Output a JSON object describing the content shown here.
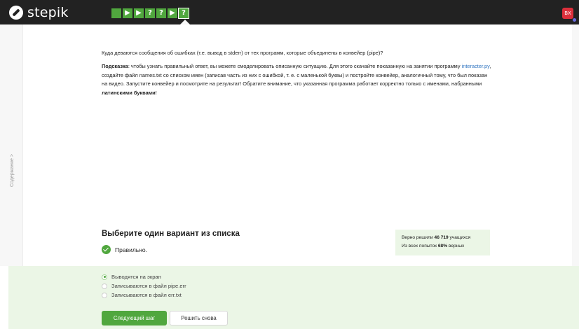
{
  "header": {
    "logo_text": "stepik",
    "steps": [
      {
        "icon": "check-square-icon",
        "glyph": " ",
        "state": "done"
      },
      {
        "icon": "play-icon",
        "glyph": "▶",
        "state": "done"
      },
      {
        "icon": "play-icon",
        "glyph": "▶",
        "state": "done"
      },
      {
        "icon": "question-icon",
        "glyph": "?",
        "state": "done"
      },
      {
        "icon": "question-icon",
        "glyph": "?",
        "state": "done"
      },
      {
        "icon": "play-icon",
        "glyph": "▶",
        "state": "done"
      },
      {
        "icon": "question-icon",
        "glyph": "?",
        "state": "active"
      }
    ],
    "avatar_initials": "BX",
    "accent_color": "#50a73e"
  },
  "sidebar": {
    "label": "Содержание >"
  },
  "question": {
    "text": "Куда деваются сообщения об ошибках (т.е. вывод в stderr) от тех программ, которые объединены в конвейер (pipe)?",
    "hint_label": "Подсказка",
    "hint_part1": ": чтобы узнать правильный ответ, вы можете смоделировать описанную ситуацию. Для этого скачайте показанную на занятии программу ",
    "hint_link": "interacter.py",
    "hint_part2": ", создайте файл names.txt со списком имен (записав часть из них с ошибкой, т. е. с маленькой буквы) и постройте конвейер, аналогичный тому, что был показан на видео. Запустите конвейер и посмотрите на результат! Обратите внимание, что указанная программа работает корректно только с именами, набранными ",
    "hint_bold": "латинскими буквами",
    "hint_end": "!"
  },
  "quiz": {
    "title": "Выберите один вариант из списка",
    "result_text": "Правильно.",
    "stats": {
      "solved_prefix": "Верно решили ",
      "solved_count": "46 719",
      "solved_suffix": " учащихся",
      "attempts_prefix": "Из всех попыток ",
      "attempts_percent": "68%",
      "attempts_suffix": " верных"
    },
    "options": [
      {
        "label": "Выводятся на экран",
        "checked": true
      },
      {
        "label": "Записываются в файл pipe.err",
        "checked": false
      },
      {
        "label": "Записываются в файл err.txt",
        "checked": false
      }
    ],
    "next_button": "Следующий шаг",
    "retry_button": "Решить снова"
  }
}
